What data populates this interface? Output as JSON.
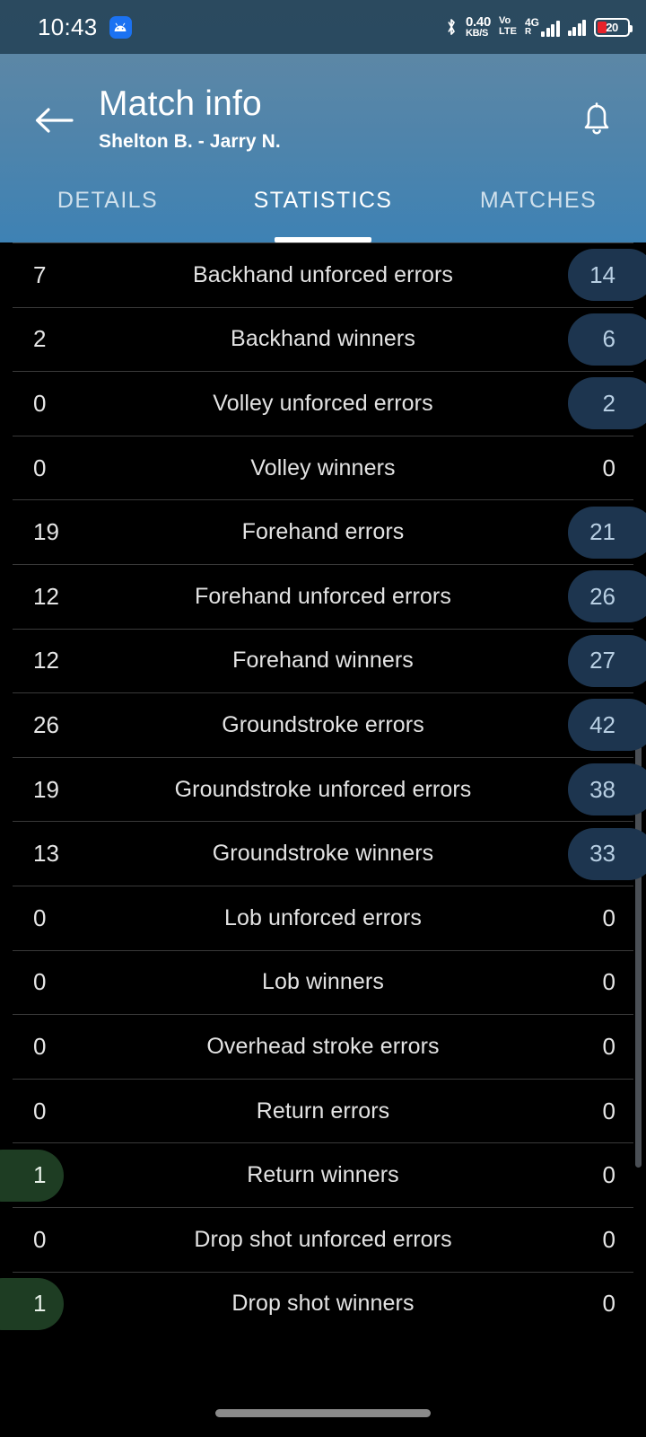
{
  "statusbar": {
    "clock": "10:43",
    "app_icon": "android-icon",
    "bluetooth_icon": "bluetooth-icon",
    "net_speed_value": "0.40",
    "net_speed_unit": "KB/S",
    "volte_line1": "Vo",
    "volte_line2": "LTE",
    "roaming_label": "R",
    "network_type": "4G",
    "battery_percent": "20"
  },
  "appbar": {
    "back_icon": "back-arrow-icon",
    "title": "Match info",
    "subtitle": "Shelton B. - Jarry N.",
    "notification_icon": "bell-icon",
    "tabs": [
      {
        "label": "DETAILS",
        "active": false
      },
      {
        "label": "STATISTICS",
        "active": true
      },
      {
        "label": "MATCHES",
        "active": false
      }
    ]
  },
  "colors": {
    "status_bar_bg": "#2a4a60",
    "appbar_gradient_start": "#5c87a6",
    "appbar_gradient_end": "#3e82b4",
    "tab_active": "#ffffff",
    "tab_inactive": "#cfe0ec",
    "list_bg": "#000000",
    "divider": "#3a3a3a",
    "badge_blue": "#1d354f",
    "badge_blue_text": "#b8cfe3",
    "badge_green": "#1e3d23",
    "badge_green_text": "#e8f1e9",
    "scrollbar": "#4a4f55",
    "nav_pill": "#8a8a8a"
  },
  "statistics": {
    "rows": [
      {
        "home": "7",
        "label": "Backhand unforced errors",
        "away": "14",
        "home_badge": "none",
        "away_badge": "blue"
      },
      {
        "home": "2",
        "label": "Backhand winners",
        "away": "6",
        "home_badge": "none",
        "away_badge": "blue"
      },
      {
        "home": "0",
        "label": "Volley unforced errors",
        "away": "2",
        "home_badge": "none",
        "away_badge": "blue"
      },
      {
        "home": "0",
        "label": "Volley winners",
        "away": "0",
        "home_badge": "none",
        "away_badge": "none"
      },
      {
        "home": "19",
        "label": "Forehand errors",
        "away": "21",
        "home_badge": "none",
        "away_badge": "blue"
      },
      {
        "home": "12",
        "label": "Forehand unforced errors",
        "away": "26",
        "home_badge": "none",
        "away_badge": "blue"
      },
      {
        "home": "12",
        "label": "Forehand winners",
        "away": "27",
        "home_badge": "none",
        "away_badge": "blue"
      },
      {
        "home": "26",
        "label": "Groundstroke errors",
        "away": "42",
        "home_badge": "none",
        "away_badge": "blue"
      },
      {
        "home": "19",
        "label": "Groundstroke unforced errors",
        "away": "38",
        "home_badge": "none",
        "away_badge": "blue"
      },
      {
        "home": "13",
        "label": "Groundstroke winners",
        "away": "33",
        "home_badge": "none",
        "away_badge": "blue"
      },
      {
        "home": "0",
        "label": "Lob unforced errors",
        "away": "0",
        "home_badge": "none",
        "away_badge": "none"
      },
      {
        "home": "0",
        "label": "Lob winners",
        "away": "0",
        "home_badge": "none",
        "away_badge": "none"
      },
      {
        "home": "0",
        "label": "Overhead stroke errors",
        "away": "0",
        "home_badge": "none",
        "away_badge": "none"
      },
      {
        "home": "0",
        "label": "Return errors",
        "away": "0",
        "home_badge": "none",
        "away_badge": "none"
      },
      {
        "home": "1",
        "label": "Return winners",
        "away": "0",
        "home_badge": "green",
        "away_badge": "none"
      },
      {
        "home": "0",
        "label": "Drop shot unforced errors",
        "away": "0",
        "home_badge": "none",
        "away_badge": "none"
      },
      {
        "home": "1",
        "label": "Drop shot winners",
        "away": "0",
        "home_badge": "green",
        "away_badge": "none"
      }
    ]
  },
  "navigation": {
    "home_pill": "home-gesture-pill"
  }
}
